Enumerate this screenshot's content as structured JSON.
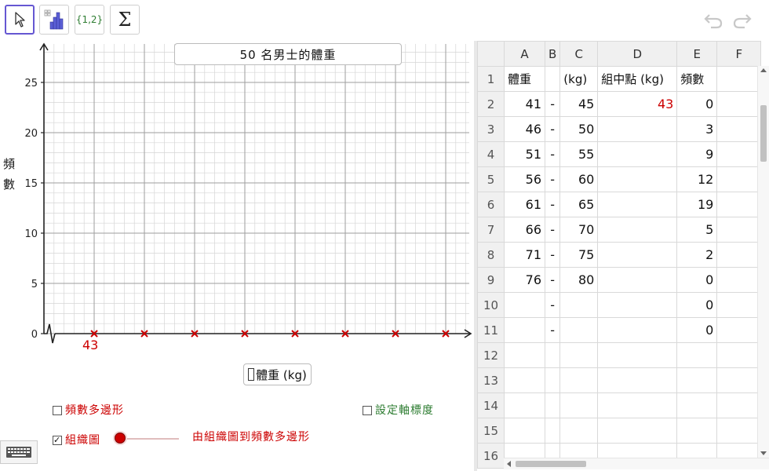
{
  "toolbar": {
    "list_label": "{1,2}",
    "sum_label": "Σ"
  },
  "graph": {
    "title": "50 名男士的體重",
    "ylabel_chars": [
      "頻",
      "數"
    ],
    "y_ticks": [
      "0",
      "5",
      "10",
      "15",
      "20",
      "25"
    ],
    "point_label": "43",
    "xlabel": "體重 (kg)",
    "checkboxes": {
      "polygon": {
        "label": "頻數多邊形",
        "checked": false,
        "color": "#cc0000"
      },
      "axis": {
        "label": "設定軸標度",
        "checked": false,
        "color": "#2e7d32"
      },
      "histogram": {
        "label": "組織圖",
        "checked": true,
        "color": "#cc0000",
        "check_mark": "✓"
      }
    },
    "slider_caption": "由組織圖到頻數多邊形",
    "point_color": "#cc0000"
  },
  "spreadsheet": {
    "columns": [
      "A",
      "B",
      "C",
      "D",
      "E",
      "F"
    ],
    "rows": [
      {
        "n": "1",
        "cells": [
          "體重",
          "",
          "(kg)",
          "組中點 (kg)",
          "頻數",
          ""
        ]
      },
      {
        "n": "2",
        "cells": [
          "41",
          "-",
          "45",
          "43",
          "0",
          ""
        ]
      },
      {
        "n": "3",
        "cells": [
          "46",
          "-",
          "50",
          "",
          "3",
          ""
        ]
      },
      {
        "n": "4",
        "cells": [
          "51",
          "-",
          "55",
          "",
          "9",
          ""
        ]
      },
      {
        "n": "5",
        "cells": [
          "56",
          "-",
          "60",
          "",
          "12",
          ""
        ]
      },
      {
        "n": "6",
        "cells": [
          "61",
          "-",
          "65",
          "",
          "19",
          ""
        ]
      },
      {
        "n": "7",
        "cells": [
          "66",
          "-",
          "70",
          "",
          "5",
          ""
        ]
      },
      {
        "n": "8",
        "cells": [
          "71",
          "-",
          "75",
          "",
          "2",
          ""
        ]
      },
      {
        "n": "9",
        "cells": [
          "76",
          "-",
          "80",
          "",
          "0",
          ""
        ]
      },
      {
        "n": "10",
        "cells": [
          "",
          "-",
          "",
          "",
          "0",
          ""
        ]
      },
      {
        "n": "11",
        "cells": [
          "",
          "-",
          "",
          "",
          "0",
          ""
        ]
      },
      {
        "n": "12",
        "cells": [
          "",
          "",
          "",
          "",
          "",
          ""
        ]
      },
      {
        "n": "13",
        "cells": [
          "",
          "",
          "",
          "",
          "",
          ""
        ]
      },
      {
        "n": "14",
        "cells": [
          "",
          "",
          "",
          "",
          "",
          ""
        ]
      },
      {
        "n": "15",
        "cells": [
          "",
          "",
          "",
          "",
          "",
          ""
        ]
      },
      {
        "n": "16",
        "cells": [
          "",
          "",
          "",
          "",
          "",
          ""
        ]
      }
    ]
  }
}
